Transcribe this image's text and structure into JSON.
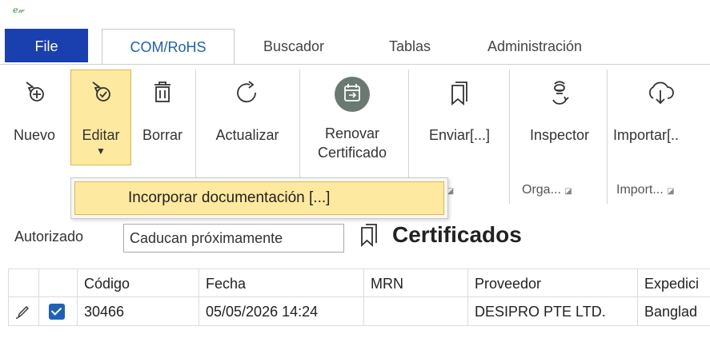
{
  "app": {
    "logo_text": "ℯ𝓌"
  },
  "tabs": [
    {
      "label": "File"
    },
    {
      "label": "COM/RoHS"
    },
    {
      "label": "Buscador"
    },
    {
      "label": "Tablas"
    },
    {
      "label": "Administración"
    }
  ],
  "ribbon": {
    "nuevo": "Nuevo",
    "editar": "Editar",
    "borrar": "Borrar",
    "actualizar": "Actualizar",
    "renovar_line1": "Renovar",
    "renovar_line2": "Certificado",
    "enviar": "Enviar[...]",
    "inspector": "Inspector",
    "importar": "Importar[..",
    "group_enviar": "...",
    "group_orga": "Orga...",
    "group_import": "Import...",
    "accent": "#fde9a0"
  },
  "dropdown": {
    "item": "Incorporar documentación [...]"
  },
  "filters": {
    "autorizado": "Autorizado",
    "caducan": "Caducan próximamente",
    "title": "Certificados"
  },
  "grid": {
    "headers": [
      "",
      "",
      "Código",
      "Fecha",
      "MRN",
      "Proveedor",
      "Expedici"
    ],
    "rows": [
      {
        "codigo": "30466",
        "fecha": "05/05/2026 14:24",
        "mrn": "",
        "proveedor": "DESIPRO PTE LTD.",
        "expedicion": "Banglad",
        "checked": true
      }
    ]
  }
}
